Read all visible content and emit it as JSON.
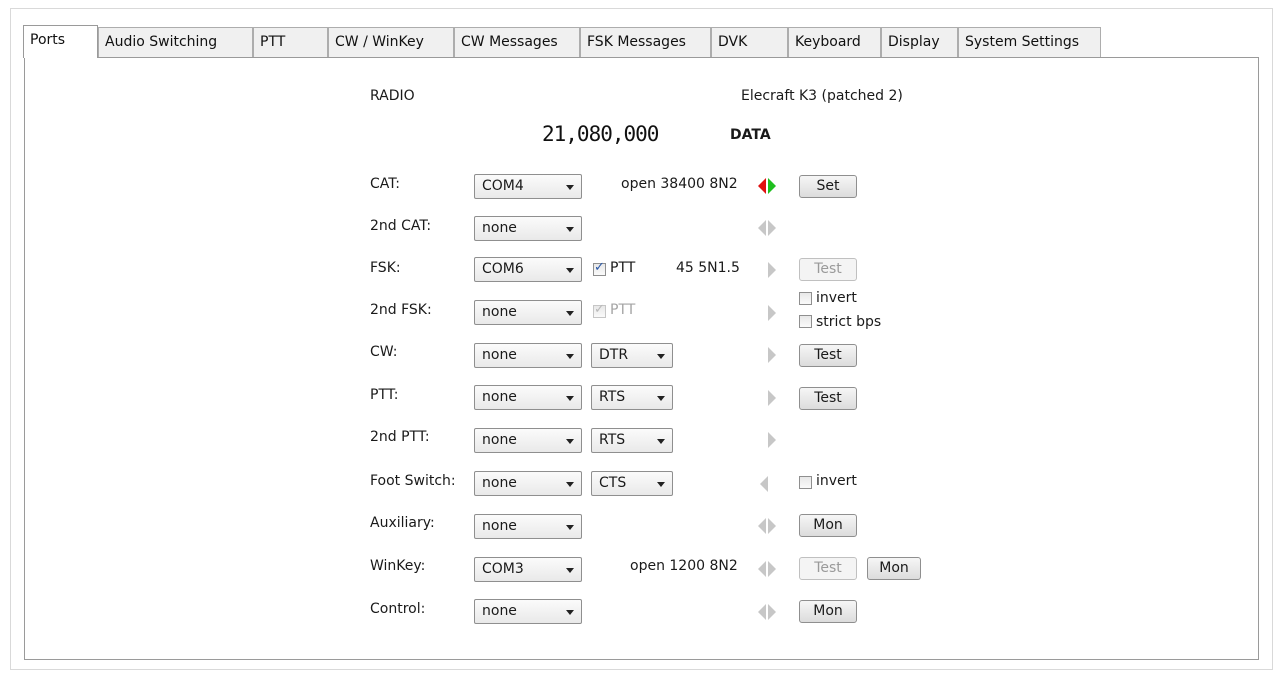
{
  "tabs": [
    "Ports",
    "Audio Switching",
    "PTT",
    "CW / WinKey",
    "CW Messages",
    "FSK Messages",
    "DVK",
    "Keyboard",
    "Display",
    "System Settings"
  ],
  "radio": {
    "label": "RADIO",
    "model": "Elecraft K3 (patched 2)",
    "frequency": "21,080,000",
    "mode": "DATA"
  },
  "rows": {
    "cat": {
      "label": "CAT:",
      "port": "COM4",
      "status": "open 38400 8N2",
      "button": "Set"
    },
    "cat2": {
      "label": "2nd CAT:",
      "port": "none"
    },
    "fsk": {
      "label": "FSK:",
      "port": "COM6",
      "ptt_label": "PTT",
      "status": "45 5N1.5",
      "button": "Test"
    },
    "fsk2": {
      "label": "2nd FSK:",
      "port": "none",
      "ptt_label": "PTT",
      "invert_label": "invert",
      "strict_label": "strict bps"
    },
    "cw": {
      "label": "CW:",
      "port": "none",
      "line": "DTR",
      "button": "Test"
    },
    "ptt": {
      "label": "PTT:",
      "port": "none",
      "line": "RTS",
      "button": "Test"
    },
    "ptt2": {
      "label": "2nd PTT:",
      "port": "none",
      "line": "RTS"
    },
    "foot": {
      "label": "Foot Switch:",
      "port": "none",
      "line": "CTS",
      "invert_label": "invert"
    },
    "aux": {
      "label": "Auxiliary:",
      "port": "none",
      "button": "Mon"
    },
    "winkey": {
      "label": "WinKey:",
      "port": "COM3",
      "status": "open 1200 8N2",
      "test_button": "Test",
      "mon_button": "Mon"
    },
    "control": {
      "label": "Control:",
      "port": "none",
      "button": "Mon"
    }
  },
  "colors": {
    "rx_active": "#e01010",
    "tx_active": "#1fbf1f",
    "inactive": "#c7c7c7"
  }
}
